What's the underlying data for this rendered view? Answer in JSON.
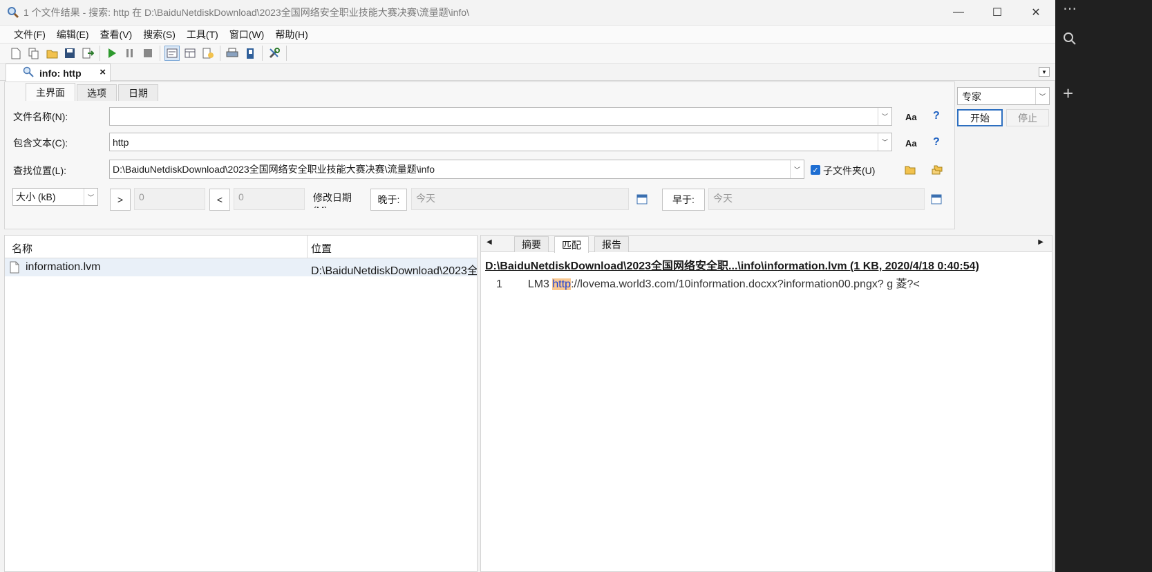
{
  "window": {
    "title": "1 个文件结果 - 搜索: http 在 D:\\BaiduNetdiskDownload\\2023全国网络安全职业技能大赛决赛\\流量题\\info\\",
    "controls": [
      "minimize-icon",
      "maximize-icon",
      "close-icon"
    ]
  },
  "menu": [
    "文件(F)",
    "编辑(E)",
    "查看(V)",
    "搜索(S)",
    "工具(T)",
    "窗口(W)",
    "帮助(H)"
  ],
  "doc_tab": {
    "label": "info: http",
    "close": "×"
  },
  "search_tabs": [
    "主界面",
    "选项",
    "日期"
  ],
  "form": {
    "filename_label": "文件名称(N):",
    "filename_value": "",
    "contains_label": "包含文本(C):",
    "contains_value": "http",
    "location_label": "查找位置(L):",
    "location_value": "D:\\BaiduNetdiskDownload\\2023全国网络安全职业技能大赛决赛\\流量题\\info",
    "subfolders_label": "子文件夹(U)",
    "subfolders_checked": true,
    "aa": "Aa",
    "help": "?",
    "size_unit": "大小 (kB)",
    "gt": ">",
    "gt_value": "0",
    "lt": "<",
    "lt_value": "0",
    "modified_label": "修改日期 (M)",
    "after_btn": "晚于:",
    "after_value": "今天",
    "before_btn": "早于:",
    "before_value": "今天"
  },
  "side_controls": {
    "mode": "专家",
    "start": "开始",
    "stop": "停止"
  },
  "results": {
    "columns": [
      "名称",
      "位置"
    ],
    "rows": [
      {
        "name": "information.lvm",
        "location": "D:\\BaiduNetdiskDownload\\2023全"
      }
    ]
  },
  "preview": {
    "tabs": [
      "摘要",
      "匹配",
      "报告"
    ],
    "active_tab": "匹配",
    "file_header": "D:\\BaiduNetdiskDownload\\2023全国网络安全职...\\info\\information.lvm   (1 KB,  2020/4/18 0:40:54)",
    "match_line_no": "1",
    "match_before": "LM3 ",
    "match_hit": "http",
    "match_after": "://lovema.world3.com/10information.docxx?information00.pngx?    g 菱?<"
  },
  "colors": {
    "accent": "#1e6ed2",
    "highlight": "#f9c891",
    "selection": "#e9f0f8"
  }
}
